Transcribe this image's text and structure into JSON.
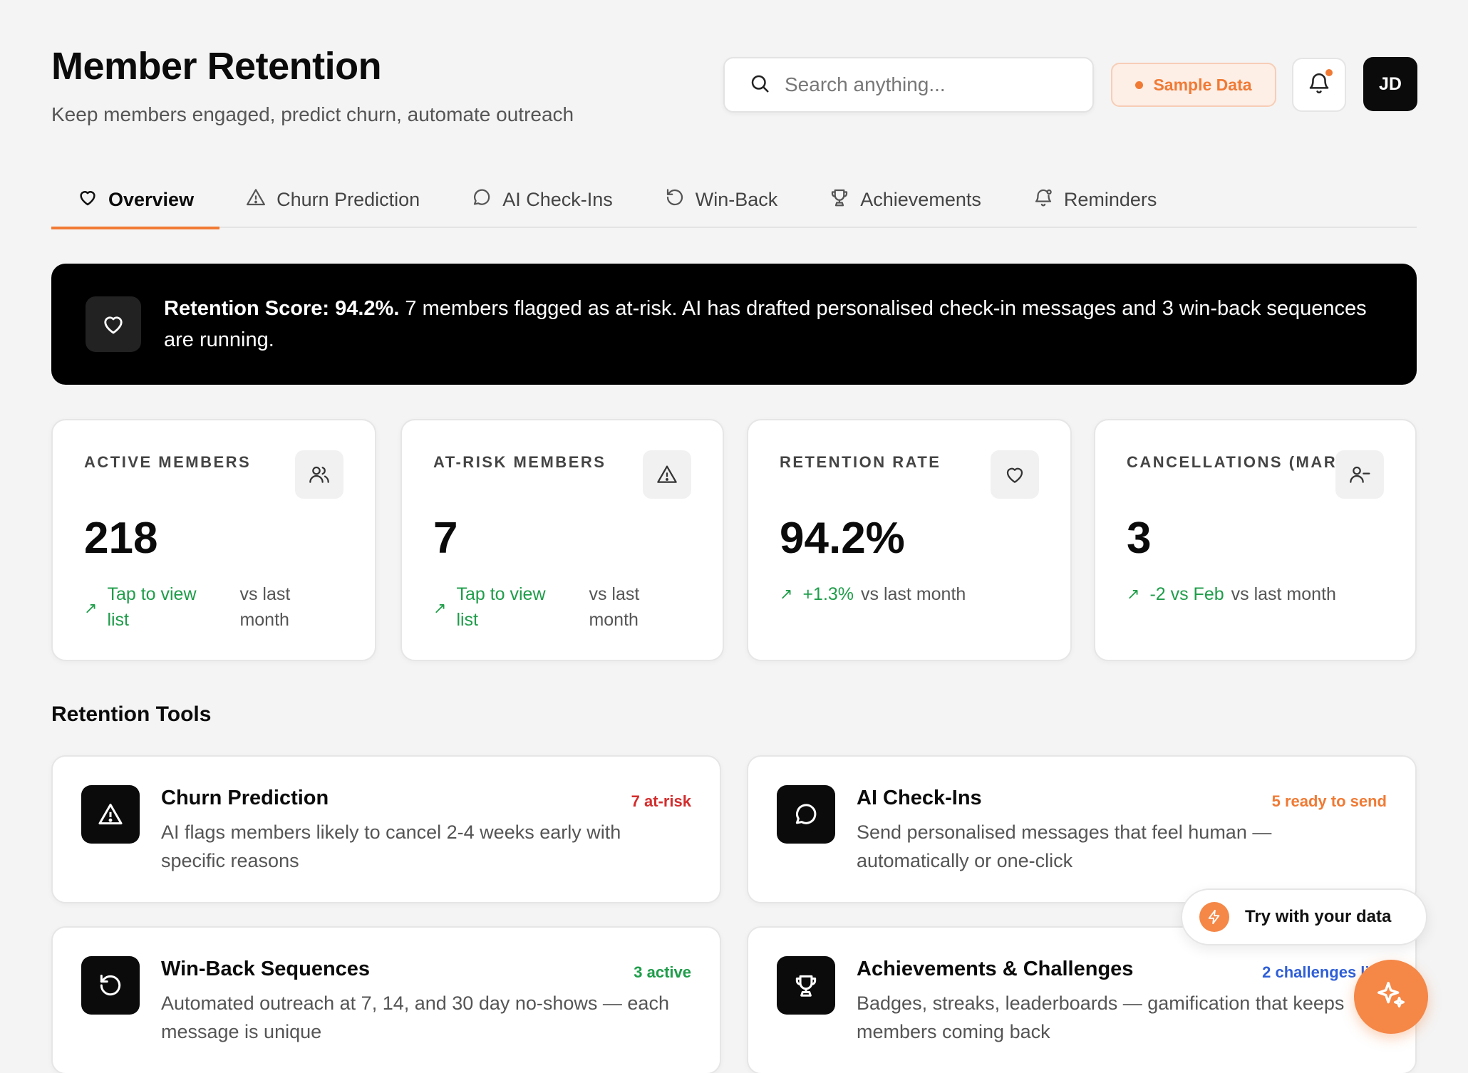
{
  "header": {
    "title": "Member Retention",
    "subtitle": "Keep members engaged, predict churn, automate outreach"
  },
  "search": {
    "placeholder": "Search anything...",
    "icon": "search-icon"
  },
  "badge": {
    "label": "Sample Data"
  },
  "notifications": {
    "icon": "bell-icon",
    "has_unread": true
  },
  "user": {
    "initials": "JD"
  },
  "tabs": [
    {
      "label": "Overview",
      "icon": "heart-icon",
      "active": true
    },
    {
      "label": "Churn Prediction",
      "icon": "warning-triangle-icon"
    },
    {
      "label": "AI Check-Ins",
      "icon": "chat-bubble-icon"
    },
    {
      "label": "Win-Back",
      "icon": "rotate-ccw-icon"
    },
    {
      "label": "Achievements",
      "icon": "trophy-icon"
    },
    {
      "label": "Reminders",
      "icon": "bell-ring-icon"
    }
  ],
  "banner": {
    "icon": "heart-icon",
    "strong": "Retention Score: 94.2%.",
    "text": " 7 members flagged as at-risk. AI has drafted personalised check-in messages and 3 win-back sequences are running."
  },
  "stats": [
    {
      "label": "ACTIVE MEMBERS",
      "icon": "users-icon",
      "value": "218",
      "trend": "Tap to view list",
      "compare": "vs last month"
    },
    {
      "label": "AT-RISK MEMBERS",
      "icon": "warning-triangle-icon",
      "value": "7",
      "trend": "Tap to view list",
      "compare": "vs last month"
    },
    {
      "label": "RETENTION RATE",
      "icon": "heart-icon",
      "value": "94.2%",
      "trend": "+1.3%",
      "compare": "vs last month"
    },
    {
      "label": "CANCELLATIONS (MAR)",
      "icon": "user-minus-icon",
      "value": "3",
      "trend": "-2 vs Feb",
      "compare": "vs last month"
    }
  ],
  "tools_section": {
    "title": "Retention Tools"
  },
  "tools": [
    {
      "name": "Churn Prediction",
      "icon": "warning-triangle-icon",
      "status": "7 at-risk",
      "status_color": "#d42d2d",
      "desc": "AI flags members likely to cancel 2-4 weeks early with specific reasons"
    },
    {
      "name": "AI Check-Ins",
      "icon": "chat-bubble-icon",
      "status": "5 ready to send",
      "status_color": "#f07a34",
      "desc": "Send personalised messages that feel human — automatically or one-click"
    },
    {
      "name": "Win-Back Sequences",
      "icon": "rotate-ccw-icon",
      "status": "3 active",
      "status_color": "#1f9d4a",
      "desc": "Automated outreach at 7, 14, and 30 day no-shows — each message is unique"
    },
    {
      "name": "Achievements & Challenges",
      "icon": "trophy-icon",
      "status": "2 challenges live",
      "status_color": "#2f5fd7",
      "desc": "Badges, streaks, leaderboards — gamification that keeps members coming back"
    }
  ],
  "floating": {
    "try_label": "Try with your data",
    "try_icon": "bolt-icon",
    "fab_icon": "sparkle-icon"
  },
  "colors": {
    "accent": "#f07a34",
    "positive": "#1f9d4a",
    "danger": "#d42d2d",
    "info": "#2f5fd7"
  }
}
